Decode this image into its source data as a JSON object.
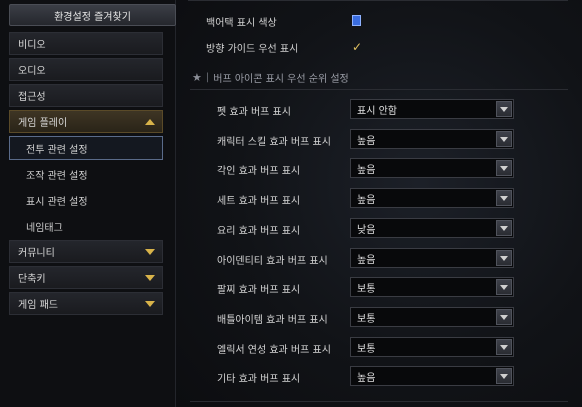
{
  "sidebar": {
    "favorites_label": "환경설정 즐겨찾기",
    "items": [
      {
        "label": "비디오"
      },
      {
        "label": "오디오"
      },
      {
        "label": "접근성"
      },
      {
        "label": "게임 플레이",
        "expanded": true,
        "icon": "chevron-up-icon"
      }
    ],
    "subitems": [
      {
        "label": "전투 관련 설정",
        "selected": true
      },
      {
        "label": "조작 관련 설정"
      },
      {
        "label": "표시 관련 설정"
      },
      {
        "label": "네임태그"
      }
    ],
    "items_after": [
      {
        "label": "커뮤니티",
        "icon": "chevron-down-icon"
      },
      {
        "label": "단축키",
        "icon": "chevron-down-icon"
      },
      {
        "label": "게임 패드",
        "icon": "chevron-down-icon"
      }
    ]
  },
  "main": {
    "backattack_color_label": "백어택 표시 색상",
    "backattack_color": "#3a6de0",
    "direction_guide_label": "방향 가이드 우선 표시",
    "direction_guide_checked": true,
    "section_title": "버프 아이콘 표시 우선 순위 설정",
    "settings": [
      {
        "label": "펫 효과 버프 표시",
        "value": "표시 안함"
      },
      {
        "label": "캐릭터 스킬 효과 버프 표시",
        "value": "높음"
      },
      {
        "label": "각인 효과 버프 표시",
        "value": "높음"
      },
      {
        "label": "세트 효과 버프 표시",
        "value": "높음"
      },
      {
        "label": "요리 효과 버프 표시",
        "value": "낮음"
      },
      {
        "label": "아이덴티티 효과 버프 표시",
        "value": "높음"
      },
      {
        "label": "팔찌 효과 버프 표시",
        "value": "보통"
      },
      {
        "label": "배틀아이템 효과 버프 표시",
        "value": "보통"
      },
      {
        "label": "엘릭서 연성 효과 버프 표시",
        "value": "보통"
      },
      {
        "label": "기타 효과 버프 표시",
        "value": "높음"
      }
    ]
  }
}
